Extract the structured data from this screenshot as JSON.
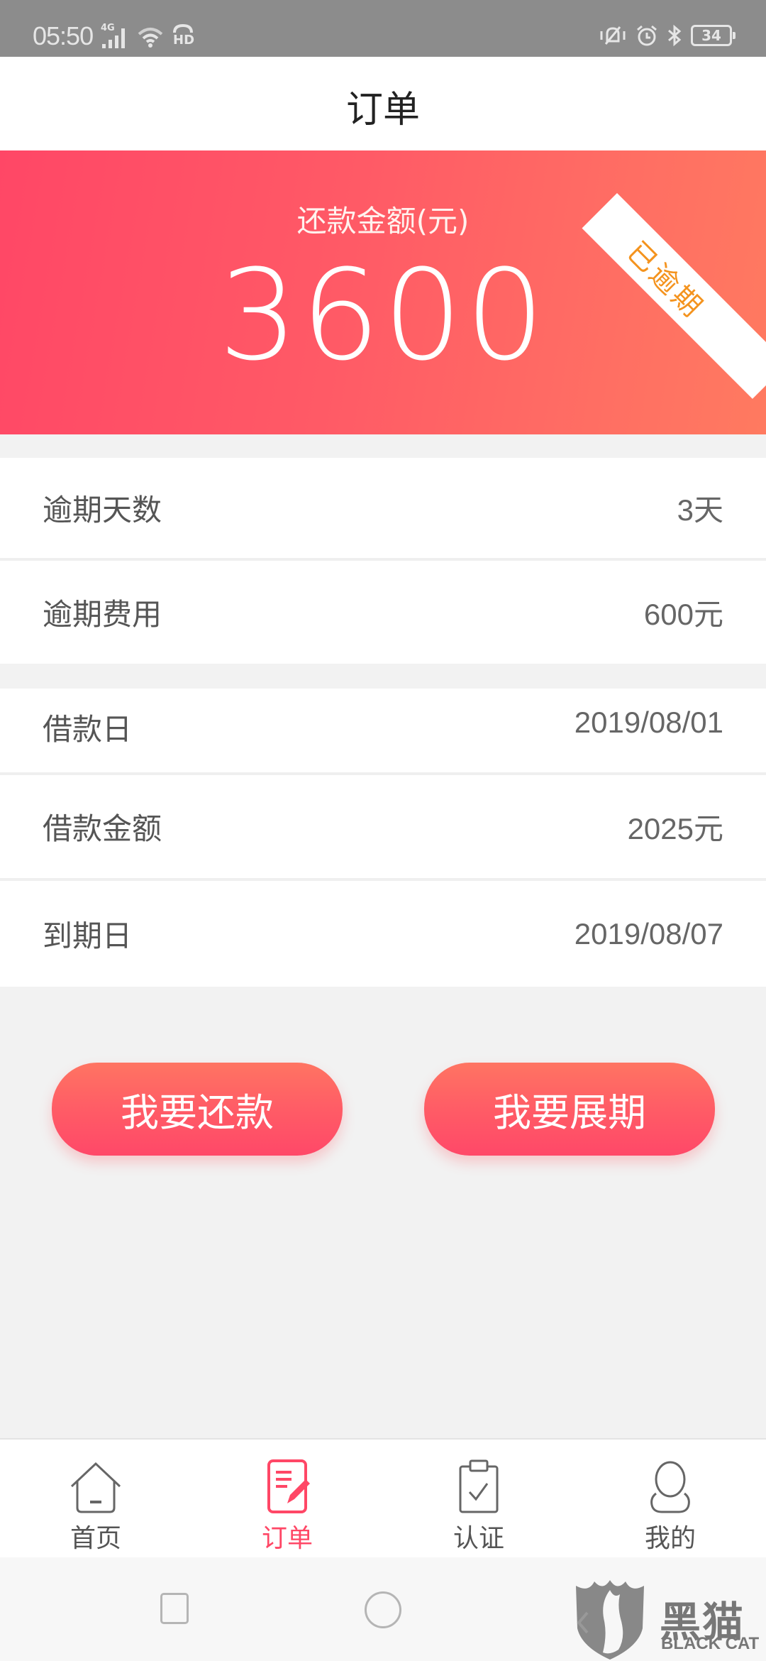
{
  "status_bar": {
    "time": "05:50",
    "network": "4G",
    "hd_label": "HD",
    "battery": "34",
    "icons": [
      "signal-icon",
      "wifi-icon",
      "hd-call-icon",
      "vibrate-icon",
      "alarm-icon",
      "bluetooth-icon",
      "battery-icon"
    ]
  },
  "header": {
    "title": "订单"
  },
  "banner": {
    "label": "还款金额(元)",
    "amount": "3600",
    "ribbon": "已逾期",
    "ribbon_color": "#f4931e",
    "gradient": [
      "#ff4766",
      "#ff7a60"
    ]
  },
  "overdue_section": [
    {
      "label": "逾期天数",
      "value": "3天"
    },
    {
      "label": "逾期费用",
      "value": "600元"
    }
  ],
  "loan_section": [
    {
      "label": "借款日",
      "value": "2019/08/01"
    },
    {
      "label": "借款金额",
      "value": "2025元"
    },
    {
      "label": "到期日",
      "value": "2019/08/07"
    }
  ],
  "actions": {
    "repay": "我要还款",
    "extend": "我要展期"
  },
  "tabs": [
    {
      "label": "首页",
      "icon": "home-icon",
      "active": false
    },
    {
      "label": "订单",
      "icon": "order-icon",
      "active": true
    },
    {
      "label": "认证",
      "icon": "clipboard-check-icon",
      "active": false
    },
    {
      "label": "我的",
      "icon": "user-icon",
      "active": false
    }
  ],
  "accent_color": "#ff4766",
  "watermark": {
    "cn": "黑猫",
    "en": "BLACK CAT"
  }
}
